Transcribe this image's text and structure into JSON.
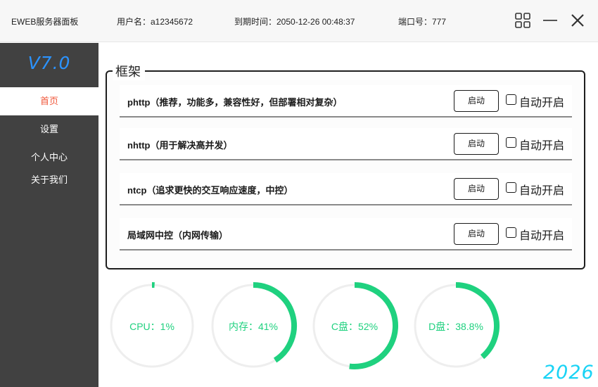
{
  "titlebar": {
    "app_name": "EWEB服务器面板",
    "username": "用户名：a12345672",
    "expire": "到期时间：2050-12-26 00:48:37",
    "port": "端口号：777",
    "icons": {
      "grid": "grid-icon",
      "minimize": "minimize-icon",
      "close": "close-icon"
    }
  },
  "sidebar": {
    "logo": "V7.0",
    "items": [
      {
        "label": "首页",
        "active": true
      },
      {
        "label": "设置",
        "active": false
      },
      {
        "label": "个人中心",
        "active": false
      },
      {
        "label": "关于我们",
        "active": false
      }
    ]
  },
  "frame": {
    "title": "框架",
    "rows": [
      {
        "label": "phttp（推荐，功能多，兼容性好，但部署相对复杂）",
        "button": "启动",
        "checkbox_label": "自动开启",
        "checked": false
      },
      {
        "label": "nhttp（用于解决高并发）",
        "button": "启动",
        "checkbox_label": "自动开启",
        "checked": false
      },
      {
        "label": "ntcp（追求更快的交互响应速度，中控）",
        "button": "启动",
        "checkbox_label": "自动开启",
        "checked": false
      },
      {
        "label": "局域网中控（内网传输）",
        "button": "启动",
        "checkbox_label": "自动开启",
        "checked": false
      }
    ]
  },
  "gauges": [
    {
      "label": "CPU：1%",
      "percent": 1
    },
    {
      "label": "内存：41%",
      "percent": 41
    },
    {
      "label": "C盘：52%",
      "percent": 52
    },
    {
      "label": "D盘：38.8%",
      "percent": 38.8
    }
  ],
  "colors": {
    "accent_green": "#1fd17f",
    "ring_track": "#eeeeee",
    "sidebar_bg": "#414141",
    "active_nav_text": "#f0573a",
    "logo": "#2b93ff",
    "year": "#19d3f5"
  },
  "footer": {
    "year": "2026"
  }
}
